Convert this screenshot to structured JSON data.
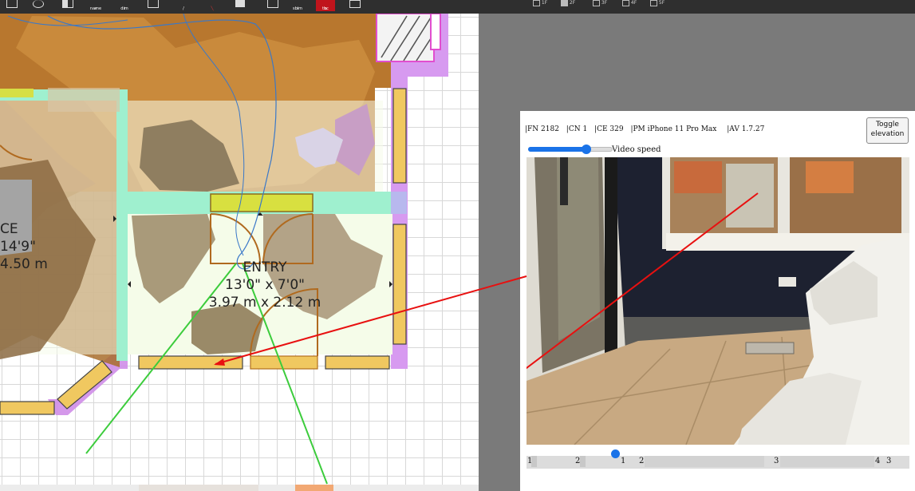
{
  "toolbar": {
    "buttons": [
      {
        "name": "frame-icon",
        "label": ""
      },
      {
        "name": "pin-icon",
        "label": ""
      },
      {
        "name": "split-icon",
        "label": ""
      },
      {
        "name": "search-icon",
        "label": "name"
      },
      {
        "name": "search-icon",
        "label": "dim"
      },
      {
        "name": "plus-box-icon",
        "label": ""
      },
      {
        "name": "pen-icon",
        "label": ""
      },
      {
        "name": "line-tool-icon",
        "label": ""
      },
      {
        "name": "fill-icon",
        "label": ""
      },
      {
        "name": "rect-icon",
        "label": ""
      },
      {
        "name": "search-icon",
        "label": "sbim"
      },
      {
        "name": "tag-icon",
        "label": "tbc"
      },
      {
        "name": "square-icon",
        "label": ""
      }
    ],
    "floor_tabs": [
      "1F",
      "2F",
      "3F",
      "4F",
      "5F"
    ]
  },
  "plan": {
    "rooms": [
      {
        "name": "CE",
        "dim_imperial": "14'9\"",
        "dim_metric": "4.50 m"
      },
      {
        "name": "ENTRY",
        "dim_imperial": "13'0\" x 7'0\"",
        "dim_metric": "3.97 m x 2.12 m"
      }
    ]
  },
  "viewer": {
    "meta": [
      {
        "key": "FN",
        "value": "2182"
      },
      {
        "key": "CN",
        "value": "1"
      },
      {
        "key": "CE",
        "value": "329"
      },
      {
        "key": "PM",
        "value": "iPhone 11 Pro Max"
      },
      {
        "key": "AV",
        "value": "1.7.27"
      }
    ],
    "meta_text": {
      "fn": "|FN 2182",
      "cn": "|CN 1",
      "ce": "|CE 329",
      "pm": "|PM iPhone 11 Pro Max",
      "av": "|AV 1.7.27"
    },
    "toggle_button": {
      "line1": "Toggle",
      "line2": "elevation"
    },
    "video_speed": {
      "label": "Video speed",
      "value": 0.7
    },
    "timeline": {
      "labels": [
        "1",
        "2",
        "1",
        "2",
        "3",
        "4",
        "3"
      ],
      "position": 0.22
    }
  },
  "colors": {
    "accent": "#1a73e8",
    "wall_yellow": "#f0c860",
    "wall_magenta": "#cc66ee",
    "sight_red": "#e81010",
    "fov_green": "#3ccc3c",
    "room_fill": "#f5fce9",
    "toolbar": "#2f2f2f"
  }
}
